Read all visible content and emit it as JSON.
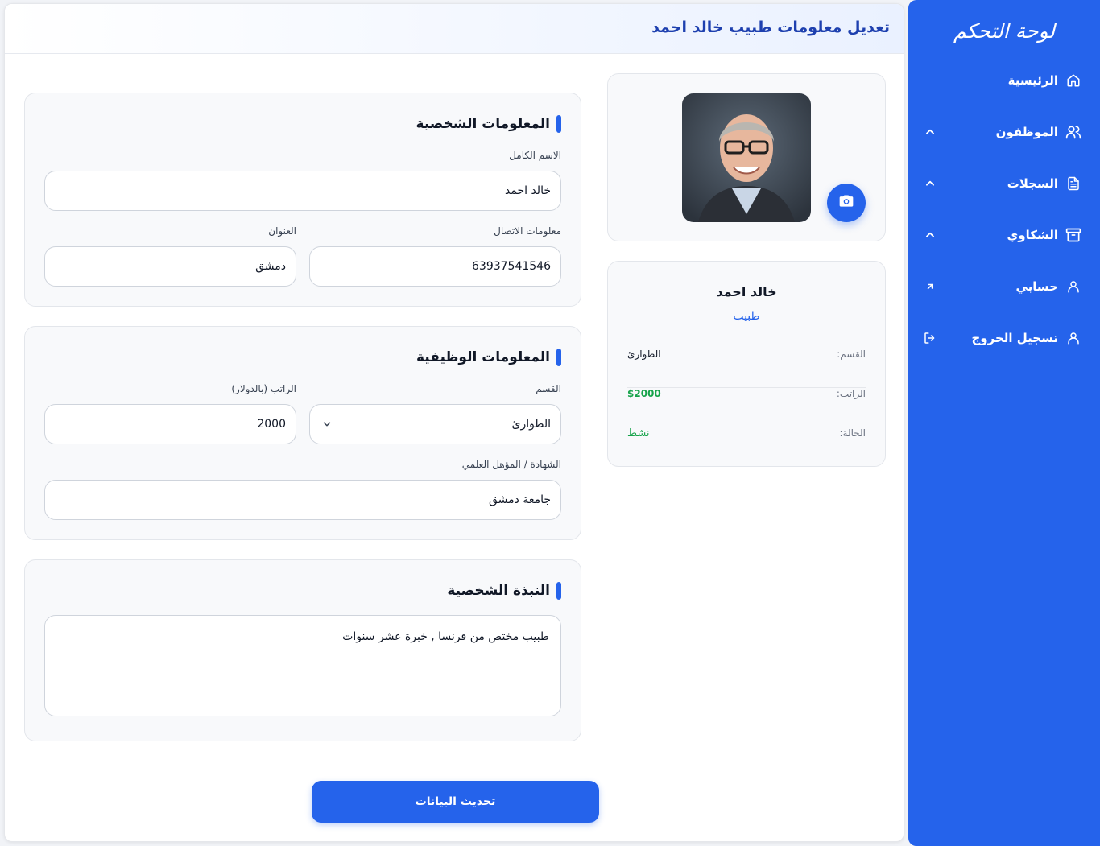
{
  "sidebar": {
    "title": "لوحة التحكم",
    "items": [
      {
        "label": "الرئيسية",
        "icon": "home-icon"
      },
      {
        "label": "الموظفون",
        "icon": "users-icon",
        "expandable": true
      },
      {
        "label": "السجلات",
        "icon": "file-icon",
        "expandable": true
      },
      {
        "label": "الشكاوي",
        "icon": "archive-icon",
        "expandable": true
      },
      {
        "label": "حسابي",
        "icon": "user-icon"
      },
      {
        "label": "تسجيل الخروج",
        "icon": "user-icon"
      }
    ]
  },
  "header": {
    "title": "تعديل معلومات طبيب خالد احمد"
  },
  "personal": {
    "title": "المعلومات الشخصية",
    "full_name_label": "الاسم الكامل",
    "full_name": "خالد احمد",
    "contact_label": "معلومات الاتصال",
    "contact": "63937541546",
    "address_label": "العنوان",
    "address": "دمشق"
  },
  "job": {
    "title": "المعلومات الوظيفية",
    "department_label": "القسم",
    "department": "الطوارئ",
    "salary_label": "الراتب (بالدولار)",
    "salary": "2000",
    "degree_label": "الشهادة / المؤهل العلمي",
    "degree": "جامعة دمشق"
  },
  "bio": {
    "title": "النبذة الشخصية",
    "text": "طبيب مختص من فرنسا , خبرة عشر سنوات"
  },
  "profile": {
    "name": "خالد احمد",
    "role": "طبيب",
    "rows": [
      {
        "key": "القسم:",
        "value": "الطوارئ",
        "color": "#111827"
      },
      {
        "key": "الراتب:",
        "value": "$2000",
        "color": "#16a34a"
      },
      {
        "key": "الحالة:",
        "value": "نشط",
        "color": "#16a34a"
      }
    ]
  },
  "actions": {
    "update_label": "تحديث البيانات"
  },
  "colors": {
    "accent": "#2563eb",
    "success": "#16a34a"
  }
}
